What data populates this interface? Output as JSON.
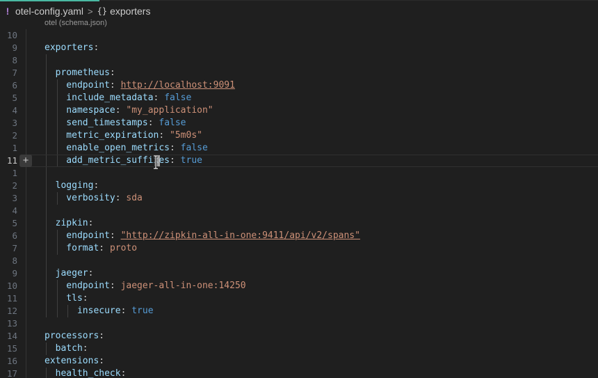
{
  "breadcrumb": {
    "file_icon": "!",
    "file_name": "otel-config.yaml",
    "separator": ">",
    "symbol_icon": "{}",
    "symbol": "exporters"
  },
  "schema_lens": "otel (schema.json)",
  "lines": [
    {
      "num": "10",
      "active": false,
      "tokens": []
    },
    {
      "num": "9",
      "active": false,
      "tokens": [
        {
          "t": "exporters",
          "c": "k"
        },
        {
          "t": ":",
          "c": "p"
        }
      ]
    },
    {
      "num": "8",
      "active": false,
      "tokens": []
    },
    {
      "num": "7",
      "active": false,
      "tokens": [
        {
          "t": "  prometheus",
          "c": "k"
        },
        {
          "t": ":",
          "c": "p"
        }
      ]
    },
    {
      "num": "6",
      "active": false,
      "tokens": [
        {
          "t": "    endpoint",
          "c": "k"
        },
        {
          "t": ": ",
          "c": "p"
        },
        {
          "t": "http://localhost:9091",
          "c": "s u"
        }
      ]
    },
    {
      "num": "5",
      "active": false,
      "tokens": [
        {
          "t": "    include_metadata",
          "c": "k"
        },
        {
          "t": ": ",
          "c": "p"
        },
        {
          "t": "false",
          "c": "b"
        }
      ]
    },
    {
      "num": "4",
      "active": false,
      "tokens": [
        {
          "t": "    namespace",
          "c": "k"
        },
        {
          "t": ": ",
          "c": "p"
        },
        {
          "t": "\"my_application\"",
          "c": "s"
        }
      ]
    },
    {
      "num": "3",
      "active": false,
      "tokens": [
        {
          "t": "    send_timestamps",
          "c": "k"
        },
        {
          "t": ": ",
          "c": "p"
        },
        {
          "t": "false",
          "c": "b"
        }
      ]
    },
    {
      "num": "2",
      "active": false,
      "tokens": [
        {
          "t": "    metric_expiration",
          "c": "k"
        },
        {
          "t": ": ",
          "c": "p"
        },
        {
          "t": "\"5m0s\"",
          "c": "s"
        }
      ]
    },
    {
      "num": "1",
      "active": false,
      "tokens": [
        {
          "t": "    enable_open_metrics",
          "c": "k"
        },
        {
          "t": ": ",
          "c": "p"
        },
        {
          "t": "false",
          "c": "b"
        }
      ]
    },
    {
      "num": "11",
      "active": true,
      "tokens": [
        {
          "t": "    add_metric_suffixes",
          "c": "k"
        },
        {
          "t": ": ",
          "c": "p"
        },
        {
          "t": "true",
          "c": "b"
        }
      ]
    },
    {
      "num": "1",
      "active": false,
      "tokens": []
    },
    {
      "num": "2",
      "active": false,
      "tokens": [
        {
          "t": "  logging",
          "c": "k"
        },
        {
          "t": ":",
          "c": "p"
        }
      ]
    },
    {
      "num": "3",
      "active": false,
      "tokens": [
        {
          "t": "    verbosity",
          "c": "k"
        },
        {
          "t": ": ",
          "c": "p"
        },
        {
          "t": "sda",
          "c": "s"
        }
      ]
    },
    {
      "num": "4",
      "active": false,
      "tokens": []
    },
    {
      "num": "5",
      "active": false,
      "tokens": [
        {
          "t": "  zipkin",
          "c": "k"
        },
        {
          "t": ":",
          "c": "p"
        }
      ]
    },
    {
      "num": "6",
      "active": false,
      "tokens": [
        {
          "t": "    endpoint",
          "c": "k"
        },
        {
          "t": ": ",
          "c": "p"
        },
        {
          "t": "\"http://zipkin-all-in-one:9411/api/v2/spans\"",
          "c": "s u"
        }
      ]
    },
    {
      "num": "7",
      "active": false,
      "tokens": [
        {
          "t": "    format",
          "c": "k"
        },
        {
          "t": ": ",
          "c": "p"
        },
        {
          "t": "proto",
          "c": "s"
        }
      ]
    },
    {
      "num": "8",
      "active": false,
      "tokens": []
    },
    {
      "num": "9",
      "active": false,
      "tokens": [
        {
          "t": "  jaeger",
          "c": "k"
        },
        {
          "t": ":",
          "c": "p"
        }
      ]
    },
    {
      "num": "10",
      "active": false,
      "tokens": [
        {
          "t": "    endpoint",
          "c": "k"
        },
        {
          "t": ": ",
          "c": "p"
        },
        {
          "t": "jaeger-all-in-one:14250",
          "c": "s"
        }
      ]
    },
    {
      "num": "11",
      "active": false,
      "tokens": [
        {
          "t": "    tls",
          "c": "k"
        },
        {
          "t": ":",
          "c": "p"
        }
      ]
    },
    {
      "num": "12",
      "active": false,
      "tokens": [
        {
          "t": "      insecure",
          "c": "k"
        },
        {
          "t": ": ",
          "c": "p"
        },
        {
          "t": "true",
          "c": "b"
        }
      ]
    },
    {
      "num": "13",
      "active": false,
      "tokens": []
    },
    {
      "num": "14",
      "active": false,
      "tokens": [
        {
          "t": "processors",
          "c": "k"
        },
        {
          "t": ":",
          "c": "p"
        }
      ]
    },
    {
      "num": "15",
      "active": false,
      "tokens": [
        {
          "t": "  batch",
          "c": "k"
        },
        {
          "t": ":",
          "c": "p"
        }
      ]
    },
    {
      "num": "16",
      "active": false,
      "tokens": [
        {
          "t": "extensions",
          "c": "k"
        },
        {
          "t": ":",
          "c": "p"
        }
      ]
    },
    {
      "num": "17",
      "active": false,
      "tokens": [
        {
          "t": "  health_check",
          "c": "k"
        },
        {
          "t": ":",
          "c": "p"
        }
      ]
    }
  ],
  "gutter_action": "+",
  "colors": {
    "background": "#1f1f1f",
    "key": "#9cdcfe",
    "string": "#ce9178",
    "boolean": "#569cd6",
    "line_number": "#6e7681",
    "active_line_number": "#cccccc"
  },
  "icons": {
    "file": "yaml-warning-icon",
    "symbol": "braces-icon",
    "gutter": "add-icon",
    "cursor": "text-cursor-icon"
  }
}
